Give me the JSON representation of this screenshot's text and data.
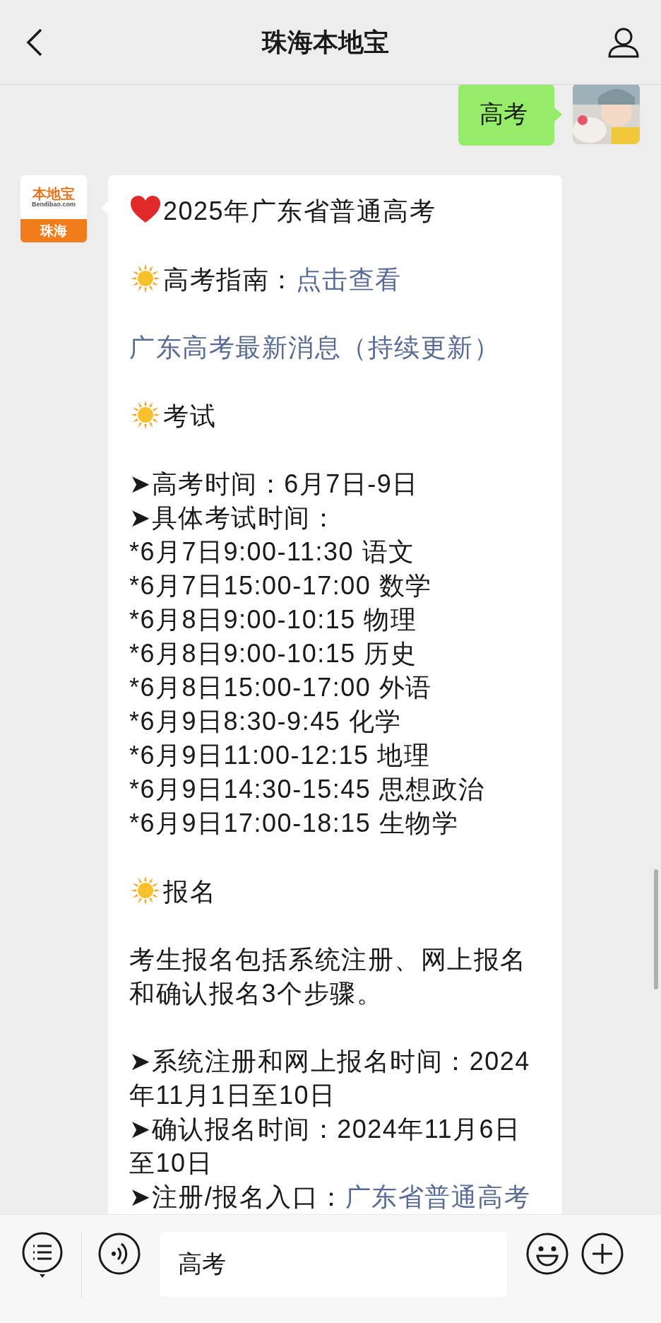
{
  "header": {
    "title": "珠海本地宝"
  },
  "sent": {
    "text": "高考"
  },
  "received": {
    "logo": {
      "brand": "本地宝",
      "site": "Bendibao.com",
      "city": "珠海"
    },
    "blocks": [
      [
        {
          "kind": "heart_heading",
          "text": "2025年广东省普通高考"
        }
      ],
      [
        {
          "kind": "sun_heading",
          "text": "高考指南：",
          "link": "点击查看"
        }
      ],
      [
        {
          "kind": "link",
          "link": "广东高考最新消息（持续更新）"
        }
      ],
      [
        {
          "kind": "sun_heading",
          "text": "考试"
        }
      ],
      [
        {
          "kind": "text",
          "text": "➤高考时间：6月7日-9日"
        },
        {
          "kind": "text",
          "text": "➤具体考试时间："
        },
        {
          "kind": "text",
          "text": "*6月7日9:00-11:30 语文"
        },
        {
          "kind": "text",
          "text": "*6月7日15:00-17:00 数学"
        },
        {
          "kind": "text",
          "text": "*6月8日9:00-10:15 物理"
        },
        {
          "kind": "text",
          "text": "*6月8日9:00-10:15 历史"
        },
        {
          "kind": "text",
          "text": "*6月8日15:00-17:00 外语"
        },
        {
          "kind": "text",
          "text": "*6月9日8:30-9:45 化学"
        },
        {
          "kind": "text",
          "text": "*6月9日11:00-12:15 地理"
        },
        {
          "kind": "text",
          "text": "*6月9日14:30-15:45 思想政治"
        },
        {
          "kind": "text",
          "text": "*6月9日17:00-18:15 生物学"
        }
      ],
      [
        {
          "kind": "sun_heading",
          "text": "报名"
        }
      ],
      [
        {
          "kind": "text",
          "text": "考生报名包括系统注册、网上报名和确认报名3个步骤。"
        }
      ],
      [
        {
          "kind": "text",
          "text": "➤系统注册和网上报名时间：2024年11月1日至10日"
        },
        {
          "kind": "text",
          "text": "➤确认报名时间：2024年11月6日至10日"
        },
        {
          "kind": "text",
          "text": "➤注册/报名入口：",
          "link": "广东省普通高考"
        }
      ]
    ]
  },
  "input": {
    "value": "高考"
  }
}
